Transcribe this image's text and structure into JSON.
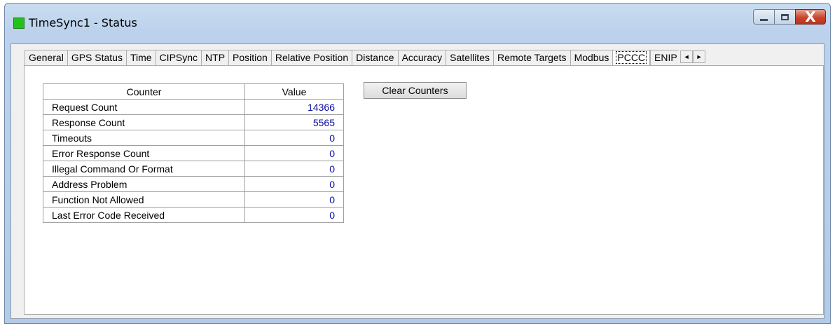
{
  "window": {
    "title": "TimeSync1 - Status",
    "controls": {
      "minimize_icon": "minimize-icon",
      "maximize_icon": "maximize-icon",
      "close_glyph": "X"
    }
  },
  "tabs": [
    {
      "label": "General"
    },
    {
      "label": "GPS Status"
    },
    {
      "label": "Time"
    },
    {
      "label": "CIPSync"
    },
    {
      "label": "NTP"
    },
    {
      "label": "Position"
    },
    {
      "label": "Relative Position"
    },
    {
      "label": "Distance"
    },
    {
      "label": "Accuracy"
    },
    {
      "label": "Satellites"
    },
    {
      "label": "Remote Targets"
    },
    {
      "label": "Modbus"
    },
    {
      "label": "PCCC",
      "selected": true
    },
    {
      "label": "ENIP"
    }
  ],
  "tab_scroll": {
    "left": "◄",
    "right": "►"
  },
  "counters": {
    "headers": {
      "counter": "Counter",
      "value": "Value"
    },
    "rows": [
      {
        "name": "Request Count",
        "value": "14366"
      },
      {
        "name": "Response Count",
        "value": "5565"
      },
      {
        "name": "Timeouts",
        "value": "0"
      },
      {
        "name": "Error Response Count",
        "value": "0"
      },
      {
        "name": "Illegal Command Or Format",
        "value": "0"
      },
      {
        "name": "Address Problem",
        "value": "0"
      },
      {
        "name": "Function Not Allowed",
        "value": "0"
      },
      {
        "name": "Last Error Code Received",
        "value": "0"
      }
    ]
  },
  "actions": {
    "clear_counters": "Clear Counters"
  },
  "colors": {
    "value_text": "#0a0ca0",
    "app_icon": "#22c21a",
    "close_button": "#c9462c"
  }
}
